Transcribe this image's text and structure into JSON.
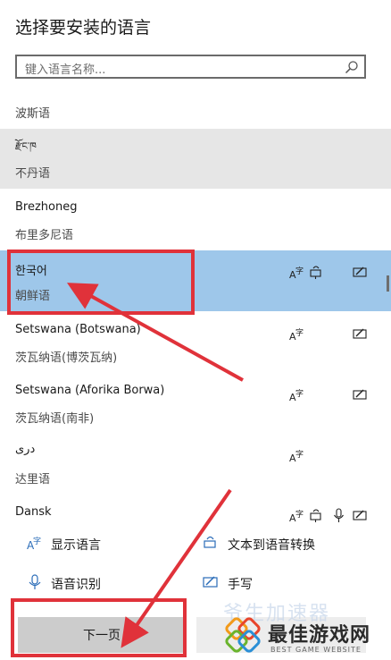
{
  "window": {
    "title": "选择要安装的语言"
  },
  "search": {
    "placeholder": "键入语言名称..."
  },
  "languages": [
    {
      "name": "",
      "sub": "波斯语",
      "state": "normal"
    },
    {
      "name": "རྫོང་ཁ",
      "sub": "不丹语",
      "state": "hover"
    },
    {
      "name": "Brezhoneg",
      "sub": "布里多尼语",
      "state": "normal"
    },
    {
      "name": "한국어",
      "sub": "朝鲜语",
      "state": "selected"
    },
    {
      "name": "Setswana (Botswana)",
      "sub": "茨瓦纳语(博茨瓦纳)",
      "state": "normal"
    },
    {
      "name": "Setswana (Aforika Borwa)",
      "sub": "茨瓦纳语(南非)",
      "state": "normal"
    },
    {
      "name": "دری",
      "sub": "达里语",
      "state": "normal"
    },
    {
      "name": "Dansk",
      "sub": "",
      "state": "normal"
    }
  ],
  "legend": {
    "display_language": "显示语言",
    "tts": "文本到语音转换",
    "speech": "语音识别",
    "handwriting": "手写"
  },
  "footer": {
    "next_label": "下一页"
  },
  "watermark": {
    "main": "最佳游戏网",
    "sub": "BEST GAME WEBSITE",
    "faint": "爷生加速器"
  },
  "colors": {
    "selected_bg": "#9ec7ea",
    "hover_bg": "#e6e6e6",
    "annotation": "#e0323a",
    "button_bg": "#cccccc"
  }
}
